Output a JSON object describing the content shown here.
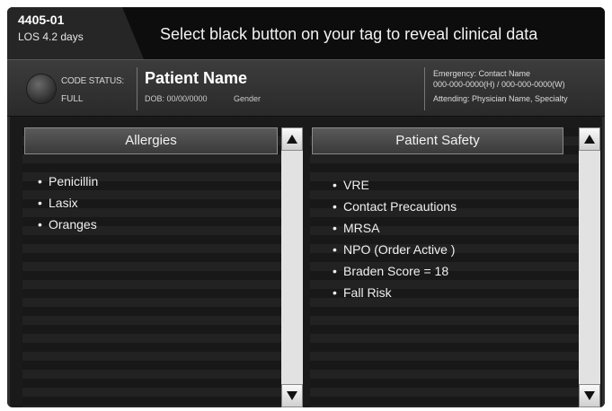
{
  "header": {
    "room_number": "4405-01",
    "los": "LOS 4.2 days",
    "instruction": "Select black button on your tag to reveal clinical data"
  },
  "patient": {
    "code_status_label": "CODE STATUS:",
    "code_status_value": "FULL",
    "name": "Patient Name",
    "dob": "DOB: 00/00/0000",
    "gender": "Gender",
    "emergency_contact": "Emergency: Contact Name",
    "emergency_phones": "000-000-0000(H) / 000-000-0000(W)",
    "attending": "Attending: Physician Name, Specialty"
  },
  "allergies": {
    "title": "Allergies",
    "items": [
      "Penicillin",
      "Lasix",
      "Oranges"
    ]
  },
  "patient_safety": {
    "title": "Patient Safety",
    "items": [
      "VRE",
      "Contact Precautions",
      "MRSA",
      "NPO (Order Active )",
      "Braden Score = 18",
      "Fall Risk"
    ]
  },
  "icons": {
    "scroll_up": "triangle-up-icon",
    "scroll_down": "triangle-down-icon",
    "code_button": "round-button-icon"
  },
  "colors": {
    "background": "#1a1a1a",
    "header_bar": "#0d0d0d",
    "text": "#f0f0f0",
    "scrollbar": "#e8e8e8"
  }
}
